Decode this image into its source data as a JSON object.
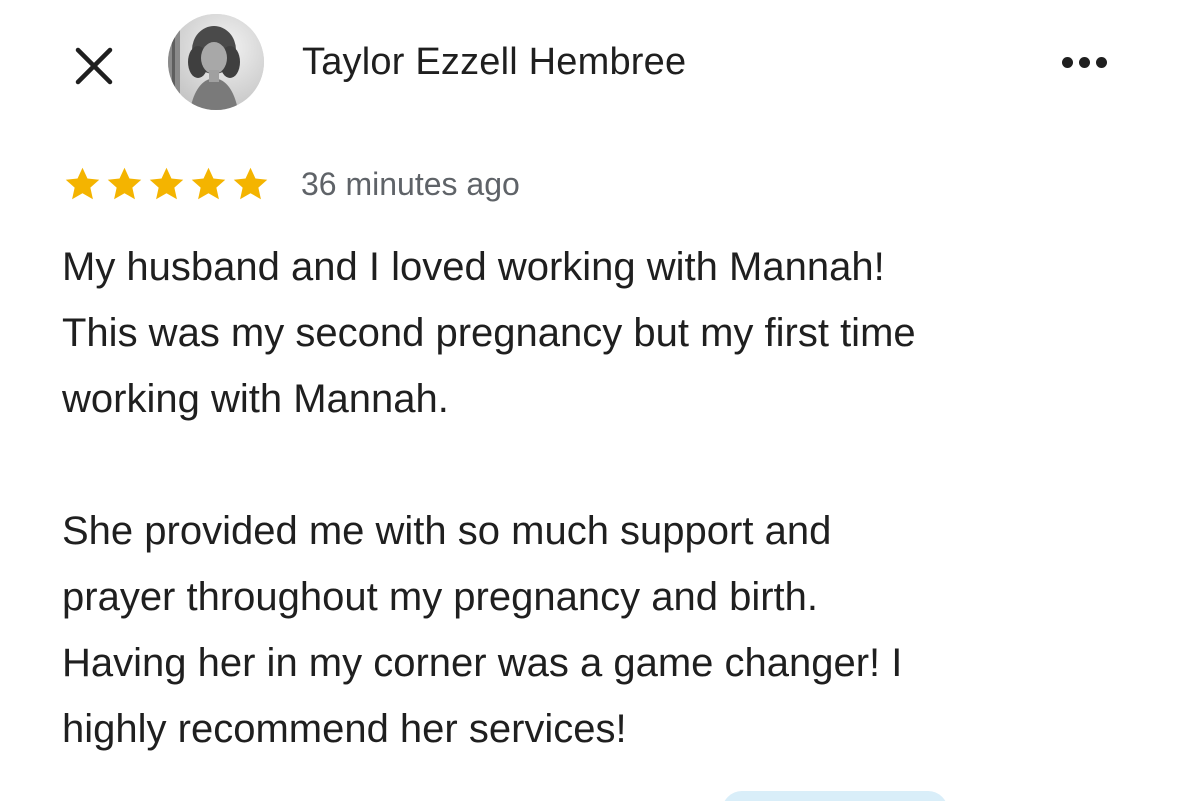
{
  "header": {
    "close_icon": "close-icon",
    "author_name": "Taylor Ezzell Hembree",
    "avatar": "avatar-photo",
    "more_icon": "more-horizontal-icon"
  },
  "review": {
    "rating": 5,
    "max_rating": 5,
    "star_color": "#F4B400",
    "timestamp": "36 minutes ago",
    "paragraphs": [
      "My husband and I loved working with Mannah!\nThis was my second pregnancy but my first time\nworking with Mannah.",
      "She provided me with so much support and\nprayer throughout my pregnancy and birth.\nHaving her in my corner was a game changer! I\nhighly recommend her services!"
    ]
  },
  "colors": {
    "text_primary": "#1F1F1F",
    "text_secondary": "#5F6368",
    "accent_pill": "#D9EEF9"
  }
}
